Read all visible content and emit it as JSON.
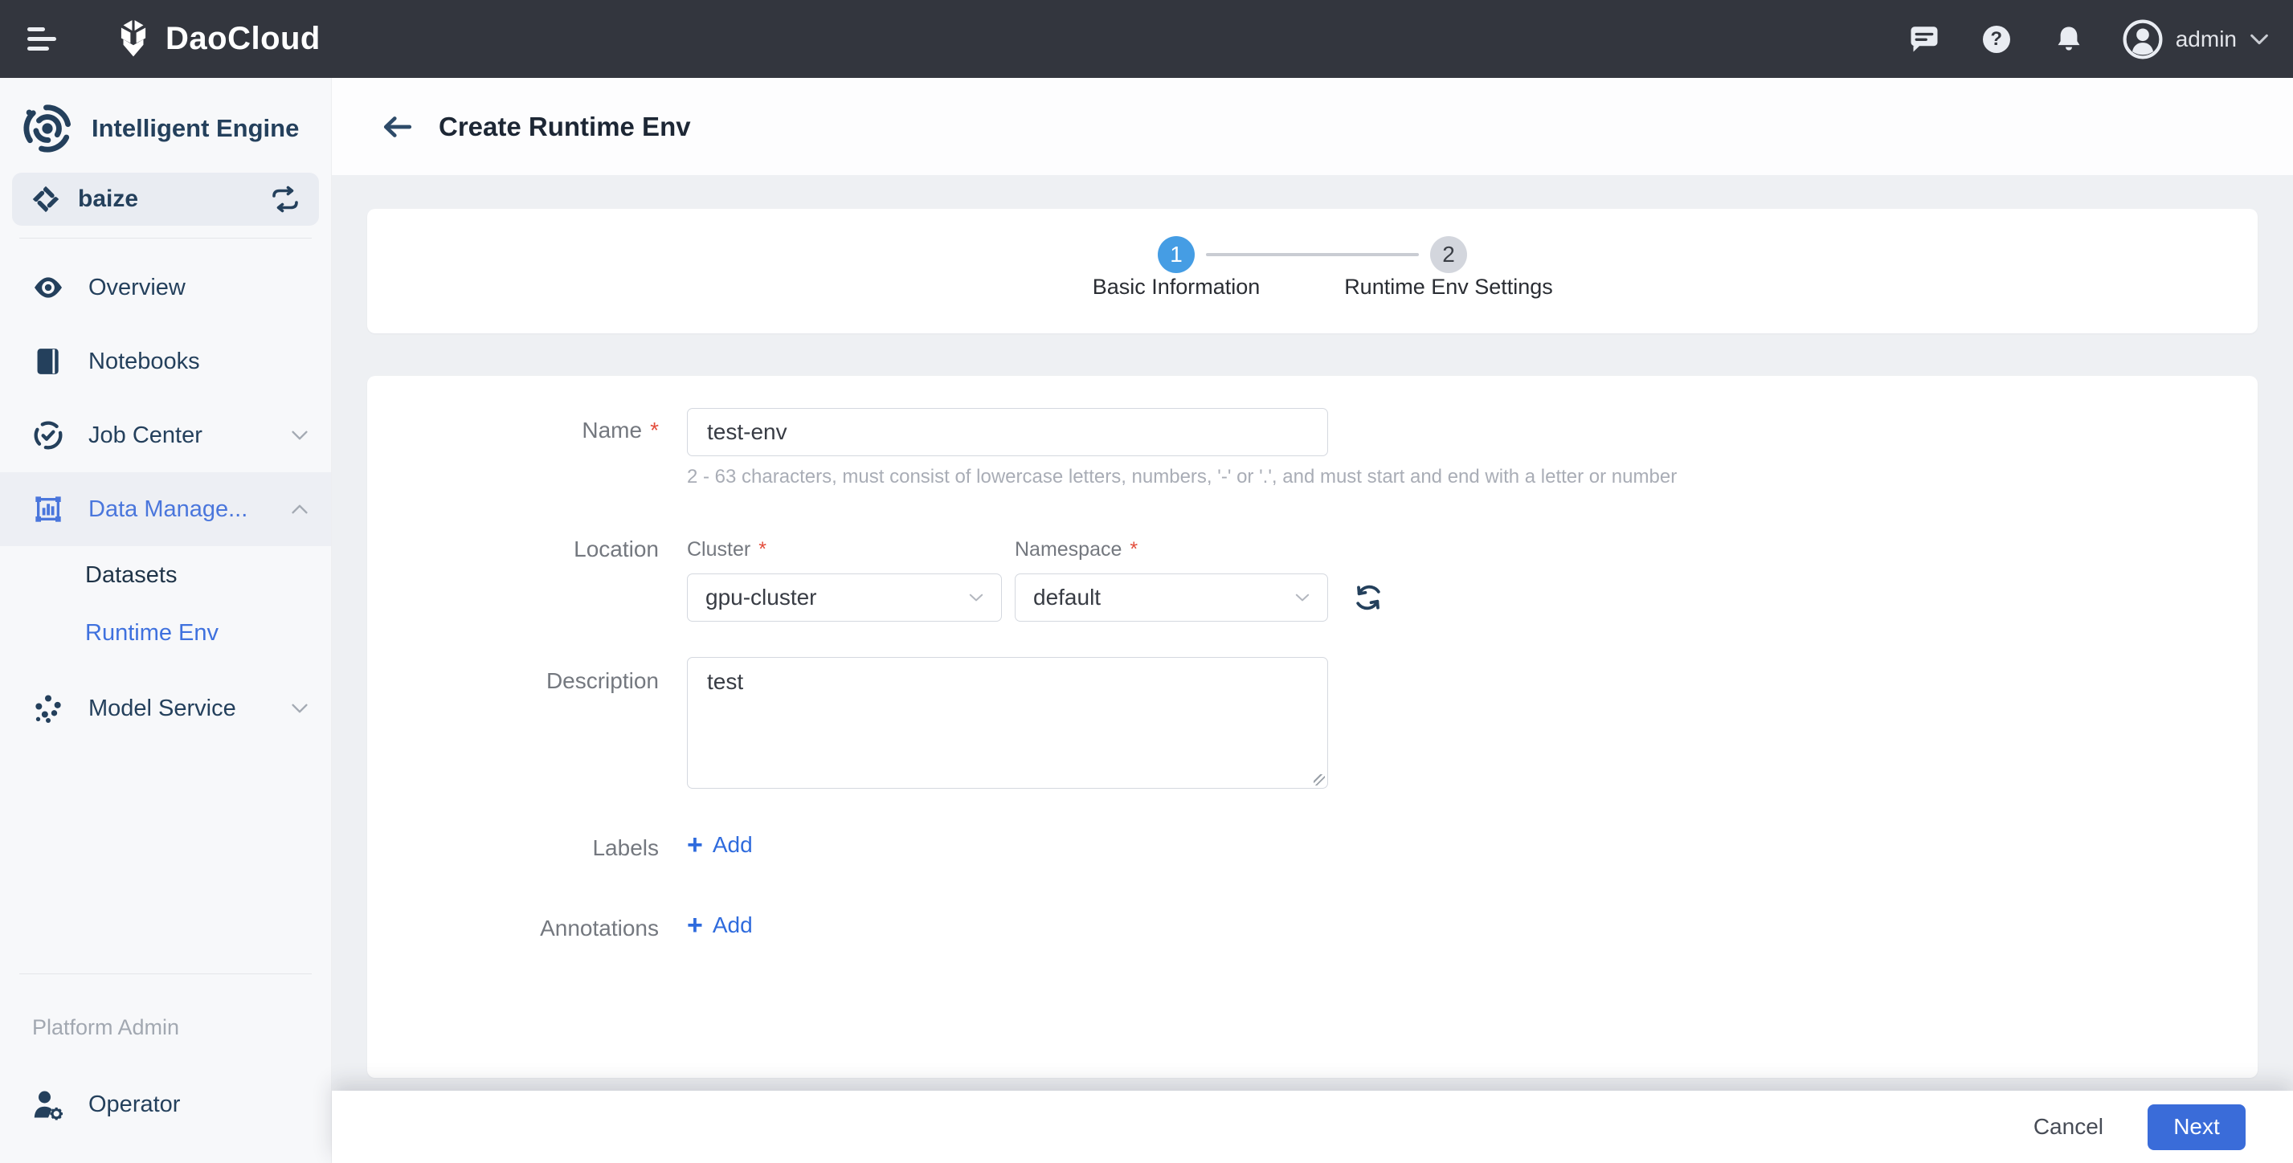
{
  "topbar": {
    "brand": "DaoCloud",
    "user": "admin",
    "icons": [
      "message-icon",
      "help-icon",
      "bell-icon",
      "avatar"
    ],
    "help_glyph": "?"
  },
  "sidebar": {
    "product": "Intelligent Engine",
    "workspace": {
      "name": "baize"
    },
    "items": [
      {
        "label": "Overview"
      },
      {
        "label": "Notebooks"
      },
      {
        "label": "Job Center",
        "chevron": "down"
      },
      {
        "label": "Data Manage...",
        "chevron": "up",
        "active": true
      },
      {
        "label": "Datasets",
        "child": true
      },
      {
        "label": "Runtime Env",
        "child": true,
        "selected": true
      },
      {
        "label": "Model Service",
        "chevron": "down"
      }
    ],
    "section_label": "Platform Admin",
    "operator_label": "Operator"
  },
  "header": {
    "title": "Create Runtime Env"
  },
  "stepper": {
    "steps": [
      {
        "number": "1",
        "label": "Basic Information",
        "state": "active"
      },
      {
        "number": "2",
        "label": "Runtime Env Settings",
        "state": "inactive"
      }
    ]
  },
  "form": {
    "required_marker": "*",
    "name": {
      "label": "Name",
      "value": "test-env",
      "help": "2 - 63 characters, must consist of lowercase letters, numbers, '-' or '.', and must start and end with a letter or number"
    },
    "location": {
      "label": "Location",
      "cluster_label": "Cluster",
      "cluster_value": "gpu-cluster",
      "namespace_label": "Namespace",
      "namespace_value": "default"
    },
    "description": {
      "label": "Description",
      "value": "test"
    },
    "labels": {
      "label": "Labels",
      "add_label": "Add",
      "plus_glyph": "+"
    },
    "annotations": {
      "label": "Annotations",
      "add_label": "Add",
      "plus_glyph": "+"
    }
  },
  "footer": {
    "cancel_label": "Cancel",
    "next_label": "Next"
  },
  "colors": {
    "topbar_bg": "#33363e",
    "sidebar_bg": "#f7f8fa",
    "accent_blue": "#3a6cd9",
    "step_active_blue": "#459de4",
    "link_blue": "#2f6bdd",
    "sidebar_active_blue": "#4a76dc",
    "navy_icon": "#24405c",
    "required_red": "#e34d3c",
    "content_bg": "#eef0f3"
  }
}
